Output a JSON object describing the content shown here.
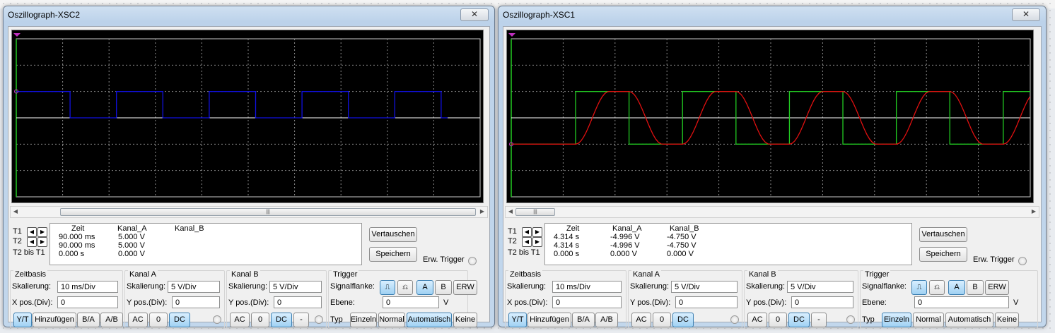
{
  "windows": [
    {
      "title": "Oszillograph-XSC2",
      "close": "✕",
      "channels": {
        "zeit": "Zeit",
        "a": "Kanal_A",
        "b": "Kanal_B"
      },
      "rows": [
        {
          "label": "T1",
          "zeit": "90.000 ms",
          "a": "5.000 V",
          "b": ""
        },
        {
          "label": "T2",
          "zeit": "90.000 ms",
          "a": "5.000 V",
          "b": ""
        },
        {
          "label": "T2 bis T1",
          "zeit": "0.000 s",
          "a": "0.000 V",
          "b": ""
        }
      ],
      "buttons": {
        "swap": "Vertauschen",
        "save": "Speichern"
      },
      "ext_trigger": "Erw. Trigger",
      "timebase": {
        "title": "Zeitbasis",
        "scale_label": "Skalierung:",
        "scale": "10 ms/Div",
        "xpos_label": "X pos.(Div):",
        "xpos": "0",
        "modes": [
          "Y/T",
          "Hinzufügen",
          "B/A",
          "A/B"
        ],
        "active_mode": "Y/T"
      },
      "channel_a": {
        "title": "Kanal A",
        "scale_label": "Skalierung:",
        "scale": "5  V/Div",
        "ypos_label": "Y pos.(Div):",
        "ypos": "0",
        "coupling": [
          "AC",
          "0",
          "DC"
        ],
        "active": "DC"
      },
      "channel_b": {
        "title": "Kanal B",
        "scale_label": "Skalierung:",
        "scale": "5  V/Div",
        "ypos_label": "Y pos.(Div):",
        "ypos": "0",
        "coupling": [
          "AC",
          "0",
          "DC",
          "-"
        ],
        "active": "DC"
      },
      "trigger": {
        "title": "Trigger",
        "edge_label": "Signalflanke:",
        "edges": [
          "A",
          "B",
          "ERW"
        ],
        "active_edge": "A",
        "level_label": "Ebene:",
        "level": "0",
        "unit": "V",
        "type_label": "Typ",
        "types": [
          "Einzeln",
          "Normal",
          "Automatisch",
          "Keine"
        ],
        "active_type": "Automatisch"
      },
      "trace_colors": {
        "a": "#1010e0",
        "ref": "#ffffff"
      },
      "waveform": "square_a_only"
    },
    {
      "title": "Oszillograph-XSC1",
      "close": "✕",
      "channels": {
        "zeit": "Zeit",
        "a": "Kanal_A",
        "b": "Kanal_B"
      },
      "rows": [
        {
          "label": "T1",
          "zeit": "4.314 s",
          "a": "-4.996 V",
          "b": "-4.750 V"
        },
        {
          "label": "T2",
          "zeit": "4.314 s",
          "a": "-4.996 V",
          "b": "-4.750 V"
        },
        {
          "label": "T2 bis T1",
          "zeit": "0.000 s",
          "a": "0.000 V",
          "b": "0.000 V"
        }
      ],
      "buttons": {
        "swap": "Vertauschen",
        "save": "Speichern"
      },
      "ext_trigger": "Erw. Trigger",
      "timebase": {
        "title": "Zeitbasis",
        "scale_label": "Skalierung:",
        "scale": "10 ms/Div",
        "xpos_label": "X pos.(Div):",
        "xpos": "0",
        "modes": [
          "Y/T",
          "Hinzufügen",
          "B/A",
          "A/B"
        ],
        "active_mode": "Y/T"
      },
      "channel_a": {
        "title": "Kanal A",
        "scale_label": "Skalierung:",
        "scale": "5  V/Div",
        "ypos_label": "Y pos.(Div):",
        "ypos": "0",
        "coupling": [
          "AC",
          "0",
          "DC"
        ],
        "active": "DC"
      },
      "channel_b": {
        "title": "Kanal B",
        "scale_label": "Skalierung:",
        "scale": "5  V/Div",
        "ypos_label": "Y pos.(Div):",
        "ypos": "0",
        "coupling": [
          "AC",
          "0",
          "DC",
          "-"
        ],
        "active": "DC"
      },
      "trigger": {
        "title": "Trigger",
        "edge_label": "Signalflanke:",
        "edges": [
          "A",
          "B",
          "ERW"
        ],
        "active_edge": "A",
        "level_label": "Ebene:",
        "level": "0",
        "unit": "V",
        "type_label": "Typ",
        "types": [
          "Einzeln",
          "Normal",
          "Automatisch",
          "Keine"
        ],
        "active_type": "Einzeln"
      },
      "trace_colors": {
        "a": "#22cc22",
        "b": "#e01010",
        "ref": "#ffffff"
      },
      "waveform": "square_and_rc"
    }
  ]
}
